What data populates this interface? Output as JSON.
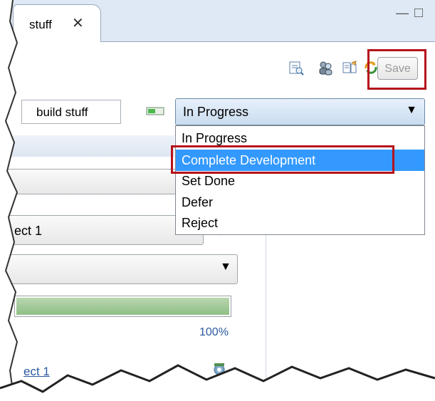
{
  "tab": {
    "title": "stuff",
    "close_symbol": "✕"
  },
  "window": {
    "minimize_symbol": "—",
    "maximize_symbol": "□"
  },
  "toolbar": {
    "icons": [
      "query-icon",
      "people-icon",
      "edit-icon",
      "refresh-icon"
    ],
    "save_label": "Save"
  },
  "header": {
    "name_value": "build stuff",
    "state": {
      "selected": "In Progress",
      "arrow": "▼"
    }
  },
  "state_menu": {
    "options": [
      "In Progress",
      "Complete Development",
      "Set Done",
      "Defer",
      "Reject"
    ],
    "highlighted": "Complete Development"
  },
  "form": {
    "project_value": "ect 1",
    "project_side": "→",
    "dropdown_arrow": "▼",
    "progress_percent": 100,
    "progress_label": "100%",
    "link_text": "ect 1"
  },
  "colors": {
    "highlight": "#b5121b",
    "selection": "#3399ff"
  }
}
